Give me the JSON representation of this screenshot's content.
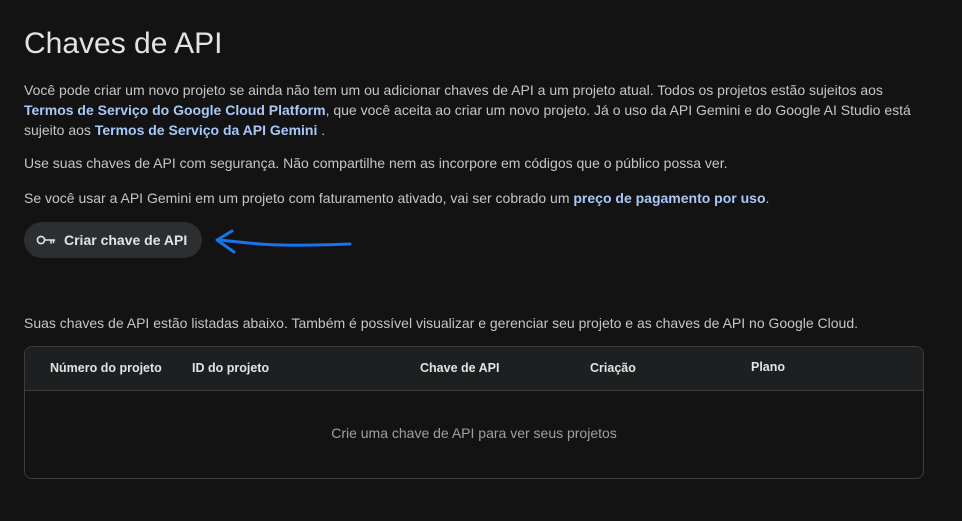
{
  "page": {
    "title": "Chaves de API"
  },
  "intro": {
    "text1": "Você pode criar um novo projeto se ainda não tem um ou adicionar chaves de API a um projeto atual. Todos os projetos estão sujeitos aos ",
    "link1": "Termos de Serviço do Google Cloud Platform",
    "text2": ", que você aceita ao criar um novo projeto. Já o uso da API Gemini e do Google AI Studio está sujeito aos ",
    "link2": "Termos de Serviço da API Gemini",
    "text3": " ."
  },
  "security_note": "Use suas chaves de API com segurança. Não compartilhe nem as incorpore em códigos que o público possa ver.",
  "billing_note": {
    "text": "Se você usar a API Gemini em um projeto com faturamento ativado, vai ser cobrado um ",
    "link": "preço de pagamento por uso",
    "end": "."
  },
  "create_button": {
    "label": "Criar chave de API",
    "icon": "key-icon"
  },
  "list_note": "Suas chaves de API estão listadas abaixo. Também é possível visualizar e gerenciar seu projeto e as chaves de API no Google Cloud.",
  "table": {
    "columns": [
      "Número do projeto",
      "ID do projeto",
      "Chave de API",
      "Criação",
      "Plano"
    ],
    "empty_message": "Crie uma chave de API para ver seus projetos"
  },
  "colors": {
    "background": "#131314",
    "link": "#a8c7fa",
    "annotation_arrow": "#1a73e8"
  }
}
